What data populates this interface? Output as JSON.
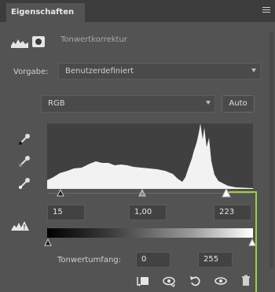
{
  "panel": {
    "tab_title": "Eigenschaften",
    "adjustment_title": "Tonwertkorrektur"
  },
  "preset": {
    "label": "Vorgabe:",
    "value": "Benutzerdefiniert"
  },
  "channel": {
    "value": "RGB",
    "auto_label": "Auto"
  },
  "input_levels": {
    "black": "15",
    "gamma": "1,00",
    "white": "223",
    "black_value": 15,
    "gamma_value": 1.0,
    "white_value": 223
  },
  "output_levels": {
    "label": "Tonwertumfang:",
    "black": "0",
    "white": "255",
    "black_value": 0,
    "white_value": 255
  },
  "colors": {
    "panel_bg": "#535353",
    "titlebar_bg": "#3c3c3c",
    "annotation": "#9bd13a",
    "histogram_fill": "#f2f2f2"
  },
  "icons": {
    "levels": "levels-icon",
    "mask": "mask-icon",
    "eyedropper_black": "eyedropper-black-icon",
    "eyedropper_gray": "eyedropper-gray-icon",
    "eyedropper_white": "eyedropper-white-icon",
    "clipping_warning": "clipping-warning-icon",
    "clip_to_layer": "clip-to-layer-icon",
    "view_previous": "view-previous-icon",
    "reset": "reset-icon",
    "visibility": "eye-icon",
    "delete": "trash-icon",
    "panel_menu": "menu-icon"
  }
}
